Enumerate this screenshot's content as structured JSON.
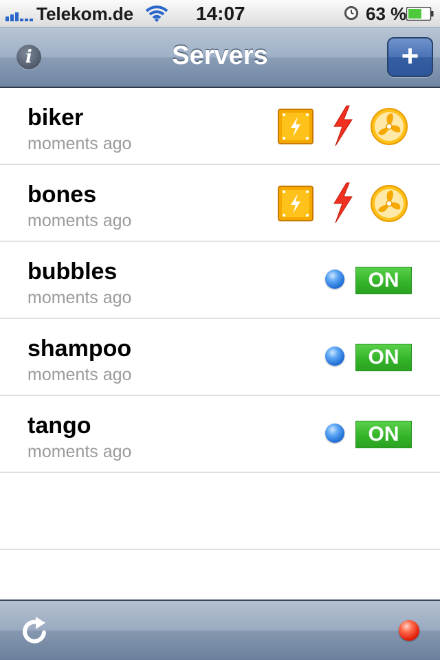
{
  "status_bar": {
    "carrier": "Telekom.de",
    "time": "14:07",
    "battery_percent": "63 %",
    "battery_level": 0.63,
    "signal_icon": "signal-bars-icon",
    "wifi_icon": "wifi-icon",
    "alarm_icon": "clock-icon"
  },
  "nav": {
    "title": "Servers",
    "info_label": "i",
    "add_label": "+"
  },
  "servers": [
    {
      "name": "biker",
      "updated": "moments ago",
      "state": "alert"
    },
    {
      "name": "bones",
      "updated": "moments ago",
      "state": "alert"
    },
    {
      "name": "bubbles",
      "updated": "moments ago",
      "state": "on",
      "badge": "ON"
    },
    {
      "name": "shampoo",
      "updated": "moments ago",
      "state": "on",
      "badge": "ON"
    },
    {
      "name": "tango",
      "updated": "moments ago",
      "state": "on",
      "badge": "ON"
    }
  ],
  "toolbar": {
    "refresh_icon": "refresh-icon",
    "connection_status_color": "#e01e0a"
  },
  "colors": {
    "status_on": "#35b52a",
    "indicator_blue": "#1f6fd6",
    "alert_orange": "#f5a800",
    "alert_red": "#f03020"
  }
}
